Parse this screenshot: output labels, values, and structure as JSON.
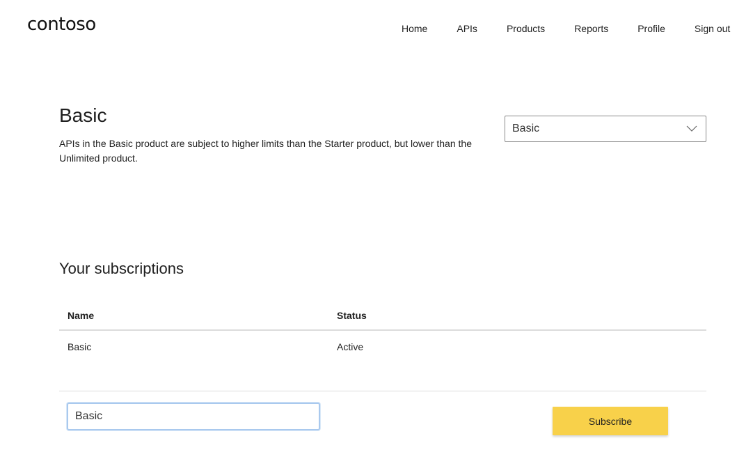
{
  "brand": {
    "logo": "contoso"
  },
  "nav": {
    "items": [
      {
        "label": "Home"
      },
      {
        "label": "APIs"
      },
      {
        "label": "Products"
      },
      {
        "label": "Reports"
      },
      {
        "label": "Profile"
      },
      {
        "label": "Sign out"
      }
    ]
  },
  "product": {
    "title": "Basic",
    "description": "APIs in the Basic product are subject to higher limits than the Starter product, but lower than the Unlimited product.",
    "selector": {
      "selected": "Basic",
      "icon": "chevron-down-icon"
    }
  },
  "subscriptions": {
    "title": "Your subscriptions",
    "columns": [
      "Name",
      "Status"
    ],
    "rows": [
      {
        "name": "Basic",
        "status": "Active"
      }
    ]
  },
  "subscribe_form": {
    "name_value": "Basic",
    "button_label": "Subscribe",
    "button_color": "#f8d14a"
  }
}
